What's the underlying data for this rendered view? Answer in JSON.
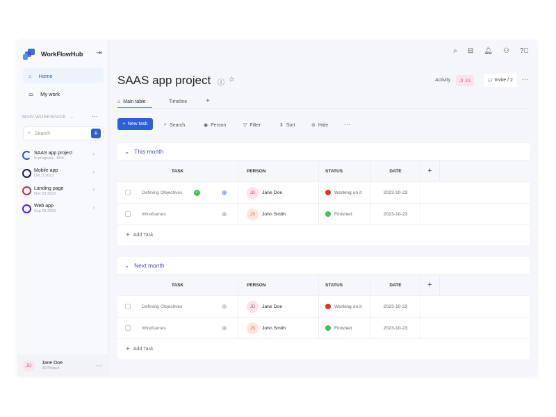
{
  "sidebar": {
    "brand": "WorkFlowHub",
    "nav": [
      {
        "label": "Home"
      },
      {
        "label": "My work"
      }
    ],
    "workspace": "MAIN WORKSPACE",
    "search_placeholder": "Search",
    "projects": [
      {
        "name": "SAAS app project",
        "sub": "In progress - 80%",
        "color": "#2e4fd6"
      },
      {
        "name": "Mobile app",
        "sub": "Dec 3 2023",
        "color": "#1a1a3a"
      },
      {
        "name": "Landing page",
        "sub": "Nov 23 2023",
        "color": "#c8284f"
      },
      {
        "name": "Web app",
        "sub": "Sep 23 2023",
        "color": "#5a18d6"
      }
    ],
    "user": {
      "initials": "JD",
      "name": "Jane Doe",
      "sub": "JD Project"
    }
  },
  "header": {
    "title": "SAAS app project",
    "activity": "Activity",
    "avatars": [
      "JI",
      "JS"
    ],
    "invite": "Invite / 2"
  },
  "tabs": [
    {
      "label": "Main table"
    },
    {
      "label": "Timeline"
    }
  ],
  "toolbar": {
    "new_task": "New task",
    "search": "Search",
    "person": "Person",
    "filter": "Filter",
    "sort": "Sort",
    "hide": "Hide"
  },
  "columns": {
    "task": "TASK",
    "person": "PERSON",
    "status": "STATUS",
    "date": "DATE"
  },
  "groups": [
    {
      "name": "This month",
      "rows": [
        {
          "task": "Defining Objectives",
          "initials": "JD",
          "person": "Jane Doe",
          "status": "Working on it",
          "status_color": "#e0341e",
          "date": "2023-10-23"
        },
        {
          "task": "Wireframes",
          "initials": "JS",
          "person": "John Smith",
          "status": "Finished",
          "status_color": "#3cc25a",
          "date": "2023-10-23"
        }
      ],
      "add": "Add Task"
    },
    {
      "name": "Next month",
      "rows": [
        {
          "task": "Defining Objectives",
          "initials": "JD",
          "person": "Jane Doe",
          "status": "Working on it",
          "status_color": "#e0341e",
          "date": "2023-10-23"
        },
        {
          "task": "Wireframes",
          "initials": "JS",
          "person": "John Smith",
          "status": "Finished",
          "status_color": "#3cc25a",
          "date": "2023-10-23"
        }
      ],
      "add": "Add Task"
    }
  ]
}
